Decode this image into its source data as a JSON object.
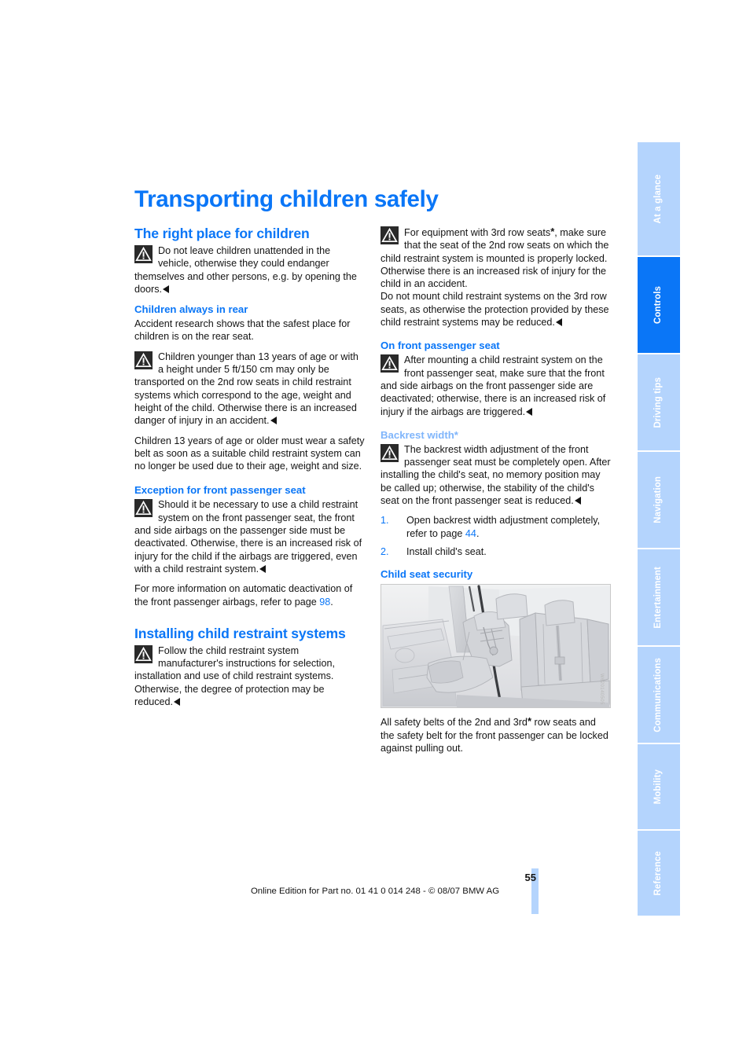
{
  "page": {
    "title": "Transporting children safely",
    "number": "55",
    "imprint": "Online Edition for Part no. 01 41 0 014 248 - © 08/07 BMW AG"
  },
  "tabs": [
    {
      "label": "At a glance",
      "active": false
    },
    {
      "label": "Controls",
      "active": true
    },
    {
      "label": "Driving tips",
      "active": false
    },
    {
      "label": "Navigation",
      "active": false
    },
    {
      "label": "Entertainment",
      "active": false
    },
    {
      "label": "Communications",
      "active": false
    },
    {
      "label": "Mobility",
      "active": false
    },
    {
      "label": "Reference",
      "active": false
    }
  ],
  "left_column": {
    "section1_heading": "The right place for children",
    "warning1": "Do not leave children unattended in the vehicle, otherwise they could endanger themselves and other persons, e.g. by opening the doors.",
    "sub1_heading": "Children always in rear",
    "para1": "Accident research shows that the safest place for children is on the rear seat.",
    "warning2": "Children younger than 13 years of age or with a height under 5 ft/150 cm may only be transported on the 2nd row seats in child restraint systems which correspond to the age, weight and height of the child. Otherwise there is an increased danger of injury in an accident.",
    "para2": "Children 13 years of age or older must wear a safety belt as soon as a suitable child restraint system can no longer be used due to their age, weight and size.",
    "sub2_heading": "Exception for front passenger seat",
    "warning3": "Should it be necessary to use a child restraint system on the front passenger seat, the front and side airbags on the passenger side must be deactivated. Otherwise, there is an increased risk of injury for the child if the airbags are triggered, even with a child restraint system.",
    "para3_before": "For more information on automatic deactivation of the front passenger airbags, refer to page ",
    "para3_xref": "98",
    "para3_after": ".",
    "section2_heading": "Installing child restraint systems",
    "warning4": "Follow the child restraint system manufacturer's instructions for selection, installation and use of child restraint systems. Otherwise, the degree of protection may be reduced."
  },
  "right_column": {
    "warning5_part1": "For equipment with 3rd row seats",
    "warning5_star": "*",
    "warning5_part2": ", make sure that the seat of the 2nd row seats on which the child restraint system is mounted is properly locked. Otherwise there is an increased risk of injury for the child in an accident.",
    "warning5_part3": "Do not mount child restraint systems on the 3rd row seats, as otherwise the protection provided by these child restraint systems may be reduced.",
    "sub1_heading": "On front passenger seat",
    "warning6": "After mounting a child restraint system on the front passenger seat, make sure that the front and side airbags on the front passenger side are deactivated; otherwise, there is an increased risk of injury if the airbags are triggered.",
    "sub2_heading": "Backrest width*",
    "warning7": "The backrest width adjustment of the front passenger seat must be completely open. After installing the child's seat, no memory position may be called up; otherwise, the stability of the child's seat on the front passenger seat is reduced.",
    "steps": [
      {
        "num": "1.",
        "text_before": "Open backrest width adjustment completely, refer to page ",
        "xref": "44",
        "text_after": "."
      },
      {
        "num": "2.",
        "text_before": "Install child's seat.",
        "xref": "",
        "text_after": ""
      }
    ],
    "sub3_heading": "Child seat security",
    "figure_watermark": "W620140505",
    "caption_part1": "All safety belts of the 2nd and 3rd",
    "caption_star": "*",
    "caption_part2": " row seats and the safety belt for the front passenger can be locked against pulling out."
  },
  "icons": {
    "warning_triangle": "warning-triangle-icon",
    "end_of_warning": "end-of-warning-marker"
  },
  "colors": {
    "accent_blue": "#0a76f7",
    "tab_inactive": "#b4d4fd",
    "sub_heading_light": "#7fb5fb",
    "text": "#141414"
  }
}
